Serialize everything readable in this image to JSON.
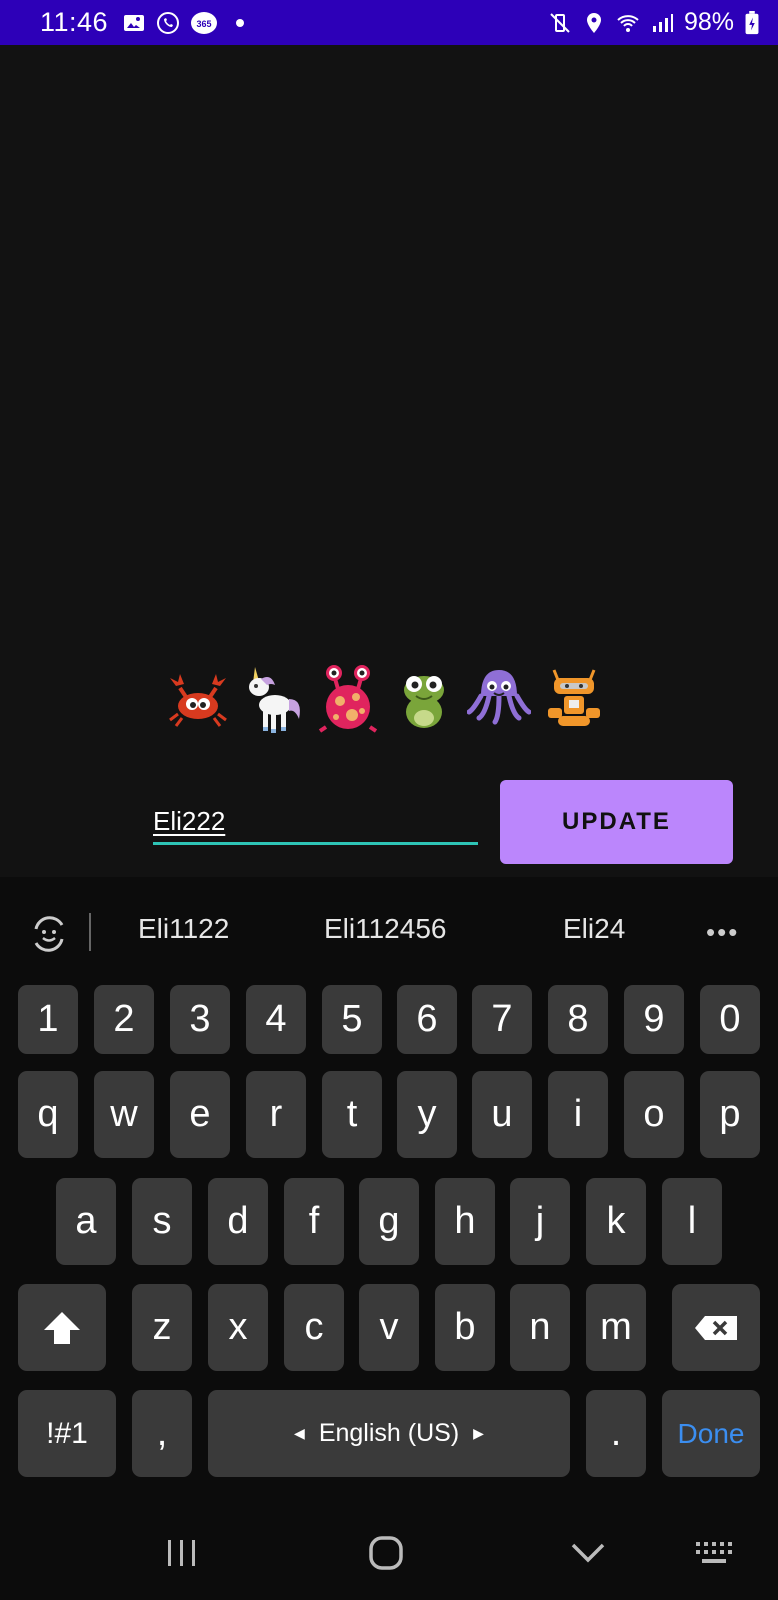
{
  "status": {
    "time": "11:46",
    "battery": "98%",
    "left_icons": [
      "gallery-icon",
      "whatsapp-icon",
      "app-badge-icon",
      "notification-dot"
    ],
    "right_icons": [
      "mute-vibrate-icon",
      "location-icon",
      "wifi-icon",
      "signal-icon",
      "battery-charging-icon"
    ]
  },
  "avatars": [
    "crab",
    "unicorn",
    "pink-monster",
    "frog",
    "octopus",
    "robot"
  ],
  "name_input": {
    "value": "Eli222"
  },
  "update_button": {
    "label": "UPDATE"
  },
  "suggestions": [
    "Eli1122",
    "Eli112456",
    "Eli24"
  ],
  "keyboard": {
    "row_numbers": [
      "1",
      "2",
      "3",
      "4",
      "5",
      "6",
      "7",
      "8",
      "9",
      "0"
    ],
    "row1": [
      "q",
      "w",
      "e",
      "r",
      "t",
      "y",
      "u",
      "i",
      "o",
      "p"
    ],
    "row2": [
      "a",
      "s",
      "d",
      "f",
      "g",
      "h",
      "j",
      "k",
      "l"
    ],
    "row3": [
      "z",
      "x",
      "c",
      "v",
      "b",
      "n",
      "m"
    ],
    "symbols_label": "!#1",
    "comma": ",",
    "space_label": "English (US)",
    "period": ".",
    "done_label": "Done"
  },
  "colors": {
    "status_bar": "#2d00b8",
    "accent_button": "#bb86fc",
    "input_underline": "#2ec4b6",
    "done_key": "#3b8ef0"
  }
}
